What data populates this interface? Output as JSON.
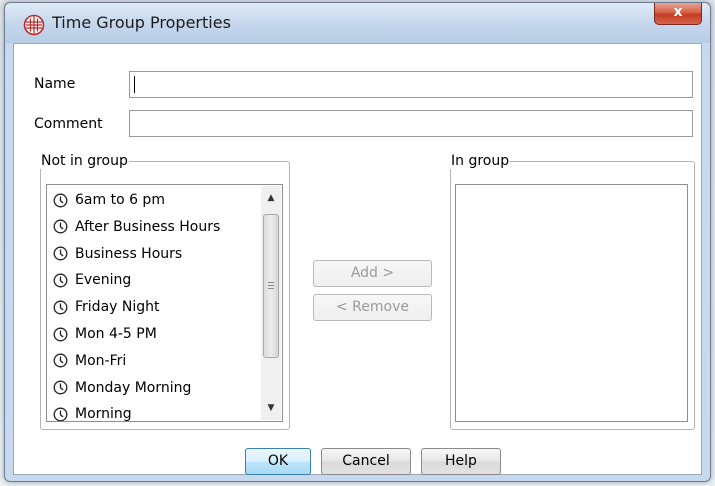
{
  "window": {
    "title": "Time Group Properties",
    "close_glyph": "x",
    "app_icon": "globe-grid-icon"
  },
  "form": {
    "name_label": "Name",
    "name_value": "",
    "comment_label": "Comment",
    "comment_value": ""
  },
  "not_in_group": {
    "legend": "Not in group",
    "items": [
      "6am to 6 pm",
      "After Business Hours",
      "Business Hours",
      "Evening",
      "Friday Night",
      "Mon 4-5 PM",
      "Mon-Fri",
      "Monday Morning",
      "Morning"
    ],
    "item_icon": "clock-icon"
  },
  "in_group": {
    "legend": "In group",
    "items": []
  },
  "actions": {
    "add_label": "Add >",
    "remove_label": "< Remove"
  },
  "footer": {
    "ok_label": "OK",
    "cancel_label": "Cancel",
    "help_label": "Help"
  },
  "colors": {
    "title_bar": "#c4d6ec",
    "close_button": "#c43c22",
    "default_button": "#a7d9f5"
  }
}
